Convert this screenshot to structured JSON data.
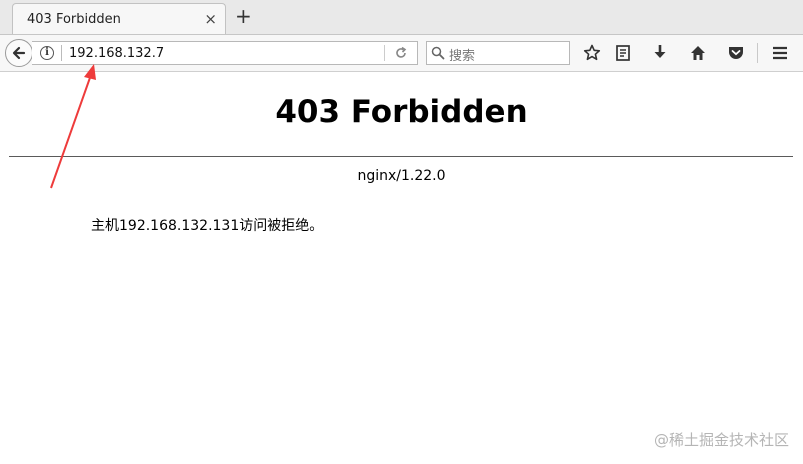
{
  "tab": {
    "title": "403 Forbidden",
    "close_glyph": "×"
  },
  "new_tab_glyph": "+",
  "address_bar": {
    "url": "192.168.132.7"
  },
  "search_bar": {
    "placeholder": "搜索"
  },
  "toolbar": {
    "icons": [
      "back-icon",
      "info-icon",
      "reload-icon",
      "search-icon",
      "bookmark-star-icon",
      "reading-list-icon",
      "download-icon",
      "home-icon",
      "pocket-icon",
      "menu-icon"
    ]
  },
  "page": {
    "heading": "403 Forbidden",
    "server": "nginx/1.22.0",
    "message": "主机192.168.132.131访问被拒绝。"
  },
  "watermark": "@稀土掘金技术社区",
  "colors": {
    "annotation_arrow": "#ee3b3b"
  }
}
